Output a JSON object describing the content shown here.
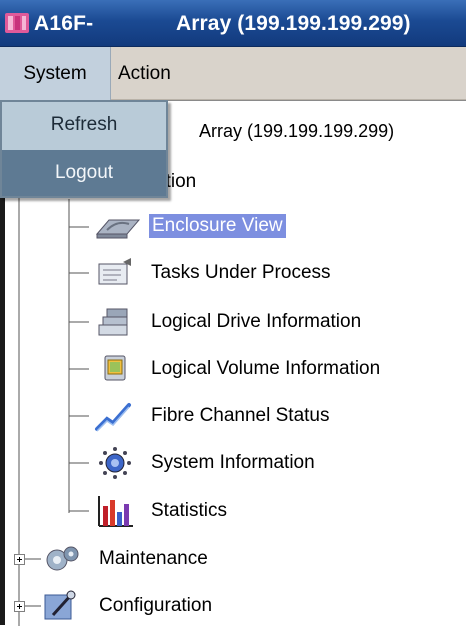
{
  "titlebar": {
    "app_name": "A16F-",
    "window_title": "Array (199.199.199.299)",
    "icon": "app-icon"
  },
  "menubar": {
    "items": [
      {
        "label": "System"
      },
      {
        "label": "Action"
      }
    ]
  },
  "system_menu": {
    "items": [
      {
        "label": "Refresh"
      },
      {
        "label": "Logout"
      }
    ]
  },
  "tree": {
    "root_label": "Array (199.199.199.299)",
    "info_label_partial": "ation",
    "children": [
      {
        "label": "Enclosure View",
        "icon": "enclosure-icon",
        "selected": true
      },
      {
        "label": "Tasks Under Process",
        "icon": "tasks-icon"
      },
      {
        "label": "Logical Drive Information",
        "icon": "logical-drive-icon"
      },
      {
        "label": "Logical Volume Information",
        "icon": "logical-volume-icon"
      },
      {
        "label": "Fibre Channel Status",
        "icon": "fibre-channel-icon"
      },
      {
        "label": "System Information",
        "icon": "system-info-icon"
      },
      {
        "label": "Statistics",
        "icon": "statistics-icon"
      }
    ],
    "top_nodes": [
      {
        "label": "Maintenance",
        "icon": "maintenance-icon"
      },
      {
        "label": "Configuration",
        "icon": "configuration-icon"
      }
    ]
  },
  "colors": {
    "titlebar": "#1b4a93",
    "menubar": "#d9d3cb",
    "dropdown": "#b9cbd8",
    "dropdown_selected": "#5e7a93",
    "selection": "#7d8fe0"
  }
}
